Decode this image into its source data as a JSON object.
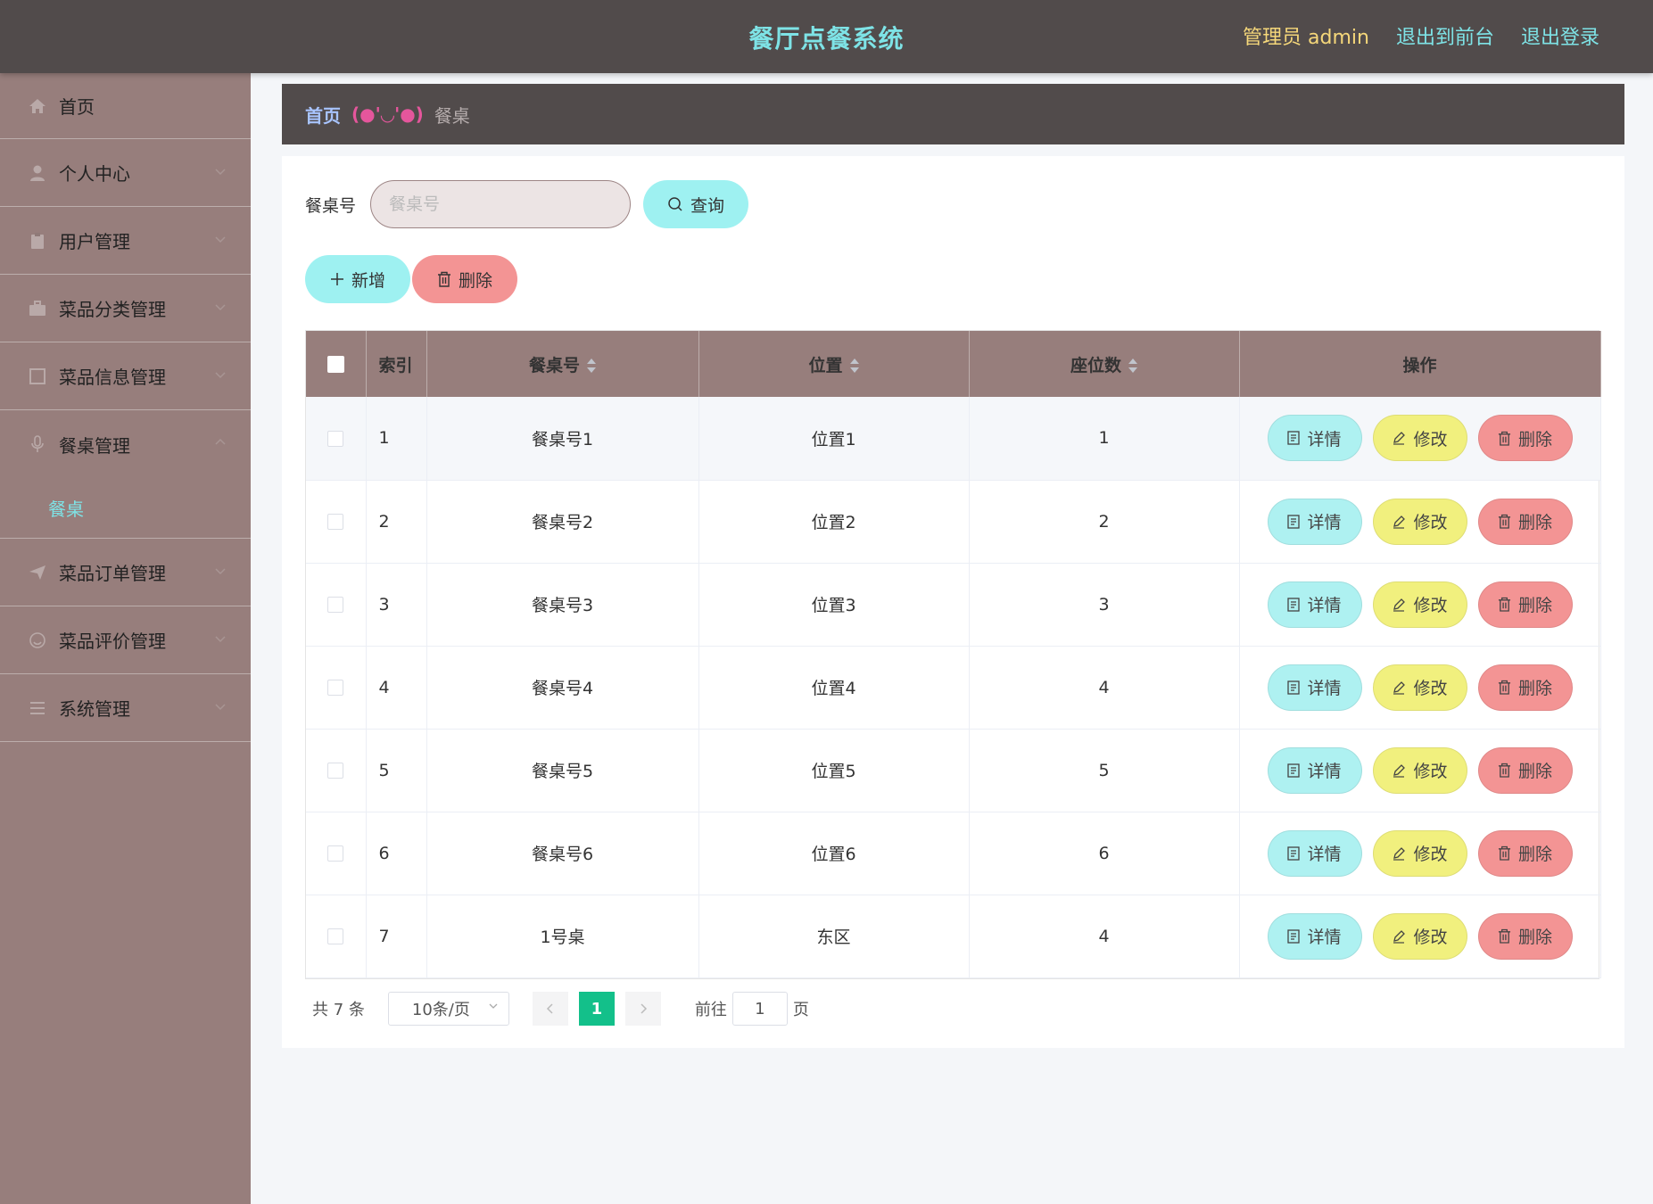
{
  "header": {
    "title": "餐厅点餐系统",
    "admin_label": "管理员 admin",
    "back_to_front": "退出到前台",
    "logout": "退出登录"
  },
  "sidebar": {
    "items": [
      {
        "label": "首页",
        "icon": "home-icon"
      },
      {
        "label": "个人中心",
        "icon": "user-icon"
      },
      {
        "label": "用户管理",
        "icon": "clipboard-icon"
      },
      {
        "label": "菜品分类管理",
        "icon": "briefcase-icon"
      },
      {
        "label": "菜品信息管理",
        "icon": "square-icon"
      },
      {
        "label": "餐桌管理",
        "icon": "microphone-icon"
      },
      {
        "label": "菜品订单管理",
        "icon": "send-icon"
      },
      {
        "label": "菜品评价管理",
        "icon": "smile-icon"
      },
      {
        "label": "系统管理",
        "icon": "menu-icon"
      }
    ],
    "active_sub": "餐桌"
  },
  "breadcrumb": {
    "home": "首页",
    "separator": "(●'◡'●)",
    "current": "餐桌"
  },
  "search": {
    "label": "餐桌号",
    "placeholder": "餐桌号",
    "query_label": "查询"
  },
  "actions": {
    "add_label": "新增",
    "delete_label": "删除"
  },
  "table": {
    "headers": {
      "index": "索引",
      "table_no": "餐桌号",
      "location": "位置",
      "seats": "座位数",
      "ops": "操作"
    },
    "op_labels": {
      "detail": "详情",
      "edit": "修改",
      "delete": "删除"
    },
    "rows": [
      {
        "index": "1",
        "table_no": "餐桌号1",
        "location": "位置1",
        "seats": "1"
      },
      {
        "index": "2",
        "table_no": "餐桌号2",
        "location": "位置2",
        "seats": "2"
      },
      {
        "index": "3",
        "table_no": "餐桌号3",
        "location": "位置3",
        "seats": "3"
      },
      {
        "index": "4",
        "table_no": "餐桌号4",
        "location": "位置4",
        "seats": "4"
      },
      {
        "index": "5",
        "table_no": "餐桌号5",
        "location": "位置5",
        "seats": "5"
      },
      {
        "index": "6",
        "table_no": "餐桌号6",
        "location": "位置6",
        "seats": "6"
      },
      {
        "index": "7",
        "table_no": "1号桌",
        "location": "东区",
        "seats": "4"
      }
    ]
  },
  "pagination": {
    "total": "共 7 条",
    "page_size": "10条/页",
    "current_page": "1",
    "goto_label": "前往",
    "goto_value": "1",
    "page_suffix": "页"
  },
  "colors": {
    "topbar": "#514b4b",
    "sidebar": "#977e7c",
    "accent_cyan": "#9ef1f1",
    "accent_yellow": "#f1f07e",
    "accent_red": "#f39494",
    "page_active": "#13c08a"
  }
}
